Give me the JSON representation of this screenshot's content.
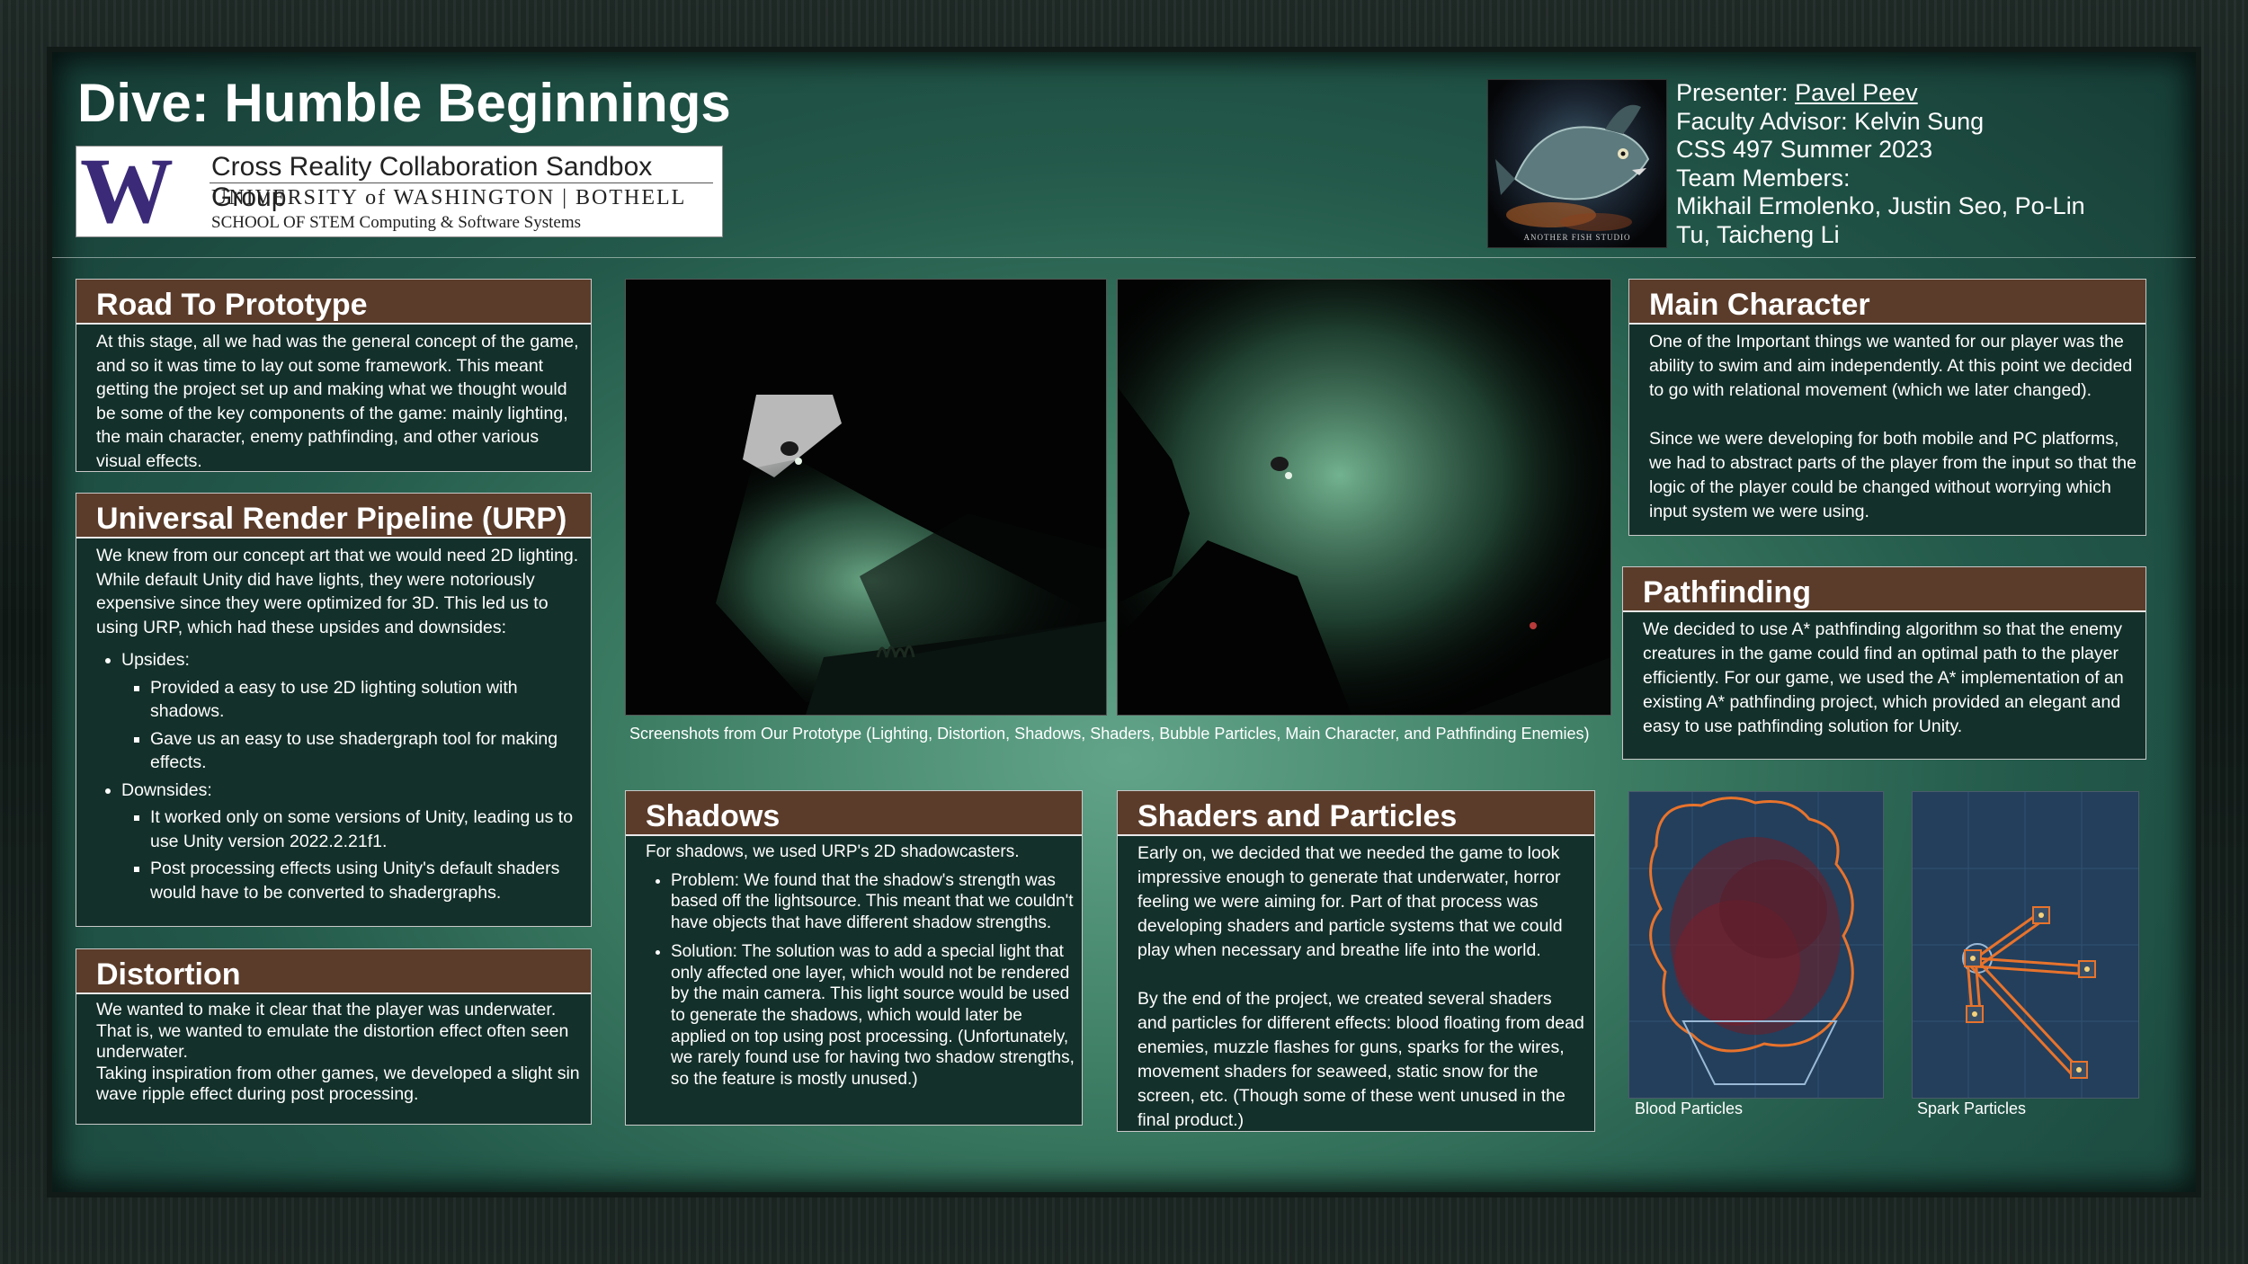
{
  "header": {
    "title": "Dive: Humble Beginnings",
    "logo": {
      "letter": "W",
      "line1": "Cross Reality Collaboration Sandbox Group",
      "line2": "UNIVERSITY of WASHINGTON | BOTHELL",
      "line3": "SCHOOL OF STEM  Computing & Software Systems"
    },
    "studio_caption": "ANOTHER FISH STUDIO",
    "presenter_label": "Presenter: ",
    "presenter_name": "Pavel Peev",
    "advisor": "Faculty Advisor: Kelvin Sung",
    "course": "CSS 497 Summer 2023",
    "team_label": "Team Members:",
    "team_line1": "Mikhail Ermolenko, Justin Seo, Po-Lin",
    "team_line2": "Tu, Taicheng Li"
  },
  "sections": {
    "road": {
      "heading": "Road To Prototype",
      "body": "At this stage, all we had was the general concept of the game, and so it was time to lay out some framework. This meant getting the project set up and making what we thought would be some of the key components of the game: mainly lighting, the main character, enemy pathfinding, and other various visual effects."
    },
    "urp": {
      "heading": "Universal Render Pipeline (URP)",
      "intro": "We knew from our concept art that we would need 2D lighting. While default Unity did have lights, they were notoriously expensive since they were optimized for 3D. This led us to using URP, which had these upsides and downsides:",
      "upsides_label": "Upsides:",
      "upside1": "Provided a easy to use 2D lighting solution with shadows.",
      "upside2": "Gave us an easy to use shadergraph tool for making effects.",
      "downsides_label": "Downsides:",
      "downside1": "It worked only on some versions of Unity, leading us to use Unity version 2022.2.21f1.",
      "downside2": "Post processing effects using Unity's default shaders would have to be converted to shadergraphs."
    },
    "distortion": {
      "heading": "Distortion",
      "p1": "We wanted to make it clear that the player was underwater. That is, we wanted to emulate the distortion effect often seen underwater.",
      "p2": "Taking inspiration from other games, we developed a slight sin wave ripple effect during post processing."
    },
    "shadows": {
      "heading": "Shadows",
      "intro": "For shadows, we used URP's 2D shadowcasters.",
      "item1": "Problem: We found that the shadow's strength was based off the lightsource. This meant that we couldn't have objects that have different shadow strengths.",
      "item2": "Solution: The solution was to add a special light that only affected one layer, which would not be rendered by the main camera. This light source would be used to generate the shadows, which would later be applied on top using post processing. (Unfortunately, we rarely found use for having two shadow strengths, so the feature is mostly unused.)"
    },
    "shaders": {
      "heading": "Shaders and Particles",
      "p1": "Early on, we decided that we needed the game to look impressive enough to generate that underwater, horror feeling we were aiming for. Part of that process was developing shaders and particle systems that we could play when necessary and breathe life into the world.",
      "p2": "By the end of the project, we created several shaders and particles for different effects: blood floating from dead enemies, muzzle flashes for guns, sparks for the wires, movement shaders for seaweed, static snow for the screen, etc. (Though some of these went unused in the final product.)"
    },
    "main_character": {
      "heading": "Main Character",
      "p1": "One of the Important things we wanted for our player was the ability to swim and aim independently. At this point we decided to go with relational movement (which we later changed).",
      "p2": "Since we were developing for both mobile and PC platforms, we had to abstract parts of the player from the input so that the logic of the player could be changed without worrying which input system we were using."
    },
    "pathfinding": {
      "heading": "Pathfinding",
      "body": "We decided to use A* pathfinding algorithm so that the enemy creatures in the game could find an optimal path to the player efficiently. For our game, we used the A* implementation of an existing A* pathfinding project, which provided an elegant and easy to use pathfinding solution for Unity."
    }
  },
  "screenshots_caption": "Screenshots from Our Prototype (Lighting, Distortion, Shadows, Shaders, Bubble Particles, Main Character, and Pathfinding Enemies)",
  "particles": {
    "blood_caption": "Blood Particles",
    "spark_caption": "Spark Particles"
  },
  "colors": {
    "heading_bar": "#5b3c2a",
    "box_bg": "#14302a",
    "uw_purple": "#3b2a78",
    "particle_bg": "#233f5c",
    "particle_outline": "#e8732c"
  }
}
